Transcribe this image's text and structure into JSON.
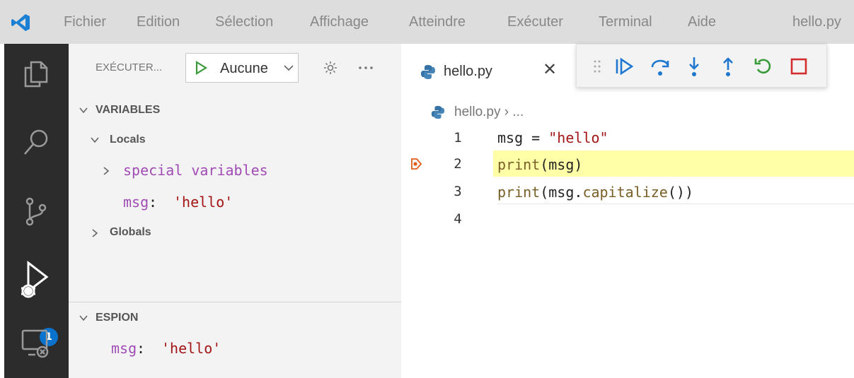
{
  "menubar": {
    "items": [
      "Fichier",
      "Edition",
      "Sélection",
      "Affichage",
      "Atteindre",
      "Exécuter",
      "Terminal",
      "Aide"
    ],
    "title": "hello.py"
  },
  "activitybar": {
    "icons": [
      "explorer-icon",
      "search-icon",
      "source-control-icon",
      "run-debug-icon",
      "remote-explorer-icon"
    ],
    "badge": "1"
  },
  "sidebar": {
    "header": "EXÉCUTER...",
    "config_value": "Aucune",
    "variables_title": "VARIABLES",
    "locals_label": "Locals",
    "special_vars_label": "special variables",
    "local_var_name": "msg",
    "local_var_value": "'hello'",
    "globals_label": "Globals",
    "watch_title": "ESPION",
    "watch_name": "msg",
    "watch_value": "'hello'"
  },
  "editor": {
    "tab_label": "hello.py",
    "breadcrumb_file": "hello.py",
    "breadcrumb_rest": "› ...",
    "line_numbers": [
      "1",
      "2",
      "3",
      "4"
    ],
    "paused_line": 2
  },
  "debug_toolbar": [
    "continue",
    "step-over",
    "step-into",
    "step-out",
    "restart",
    "stop"
  ],
  "colors": {
    "keyword_fn": "#795e26",
    "string": "#a31515",
    "variable_name": "#a14cb5",
    "highlight": "#ffffa8",
    "accent": "#0a73cd"
  }
}
